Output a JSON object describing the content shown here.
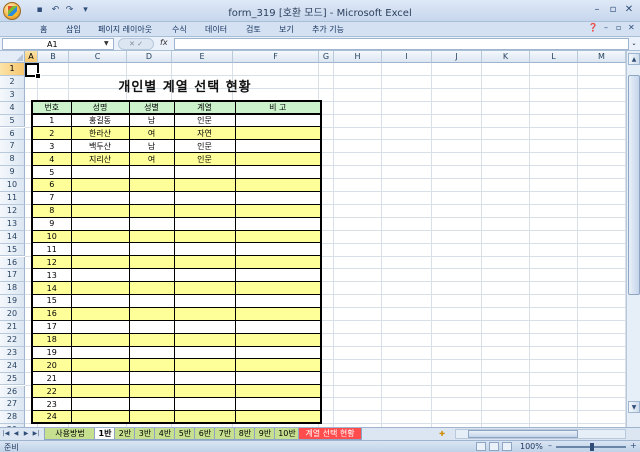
{
  "window": {
    "title": "form_319  [호환 모드] - Microsoft Excel"
  },
  "ribbon": {
    "tabs": [
      "홈",
      "삽입",
      "페이지 레이아웃",
      "수식",
      "데이터",
      "검토",
      "보기",
      "추가 기능"
    ]
  },
  "formula_bar": {
    "name_box": "A1",
    "fx": "fx",
    "formula": ""
  },
  "columns": [
    "A",
    "B",
    "C",
    "D",
    "E",
    "F",
    "G",
    "H",
    "I",
    "J",
    "K",
    "L",
    "M",
    "N"
  ],
  "rows": [
    "1",
    "2",
    "3",
    "4",
    "5",
    "6",
    "7",
    "8",
    "9",
    "10",
    "11",
    "12",
    "13",
    "14",
    "15",
    "16",
    "17",
    "18",
    "19",
    "20",
    "21",
    "22",
    "23",
    "24",
    "25",
    "26",
    "27",
    "28",
    "29"
  ],
  "sheet": {
    "title": "개인별 계열 선택 현황",
    "headers": [
      "번호",
      "성명",
      "성별",
      "계열",
      "비 고"
    ],
    "records": [
      [
        "1",
        "홍길동",
        "남",
        "인문",
        ""
      ],
      [
        "2",
        "한라산",
        "여",
        "자연",
        ""
      ],
      [
        "3",
        "백두산",
        "남",
        "인문",
        ""
      ],
      [
        "4",
        "지리산",
        "여",
        "인문",
        ""
      ],
      [
        "5",
        "",
        "",
        "",
        ""
      ],
      [
        "6",
        "",
        "",
        "",
        ""
      ],
      [
        "7",
        "",
        "",
        "",
        ""
      ],
      [
        "8",
        "",
        "",
        "",
        ""
      ],
      [
        "9",
        "",
        "",
        "",
        ""
      ],
      [
        "10",
        "",
        "",
        "",
        ""
      ],
      [
        "11",
        "",
        "",
        "",
        ""
      ],
      [
        "12",
        "",
        "",
        "",
        ""
      ],
      [
        "13",
        "",
        "",
        "",
        ""
      ],
      [
        "14",
        "",
        "",
        "",
        ""
      ],
      [
        "15",
        "",
        "",
        "",
        ""
      ],
      [
        "16",
        "",
        "",
        "",
        ""
      ],
      [
        "17",
        "",
        "",
        "",
        ""
      ],
      [
        "18",
        "",
        "",
        "",
        ""
      ],
      [
        "19",
        "",
        "",
        "",
        ""
      ],
      [
        "20",
        "",
        "",
        "",
        ""
      ],
      [
        "21",
        "",
        "",
        "",
        ""
      ],
      [
        "22",
        "",
        "",
        "",
        ""
      ],
      [
        "23",
        "",
        "",
        "",
        ""
      ],
      [
        "24",
        "",
        "",
        "",
        ""
      ]
    ]
  },
  "sheet_tabs": [
    {
      "label": "사용방법",
      "style": "normal"
    },
    {
      "label": "1반",
      "style": "active"
    },
    {
      "label": "2반",
      "style": "normal"
    },
    {
      "label": "3반",
      "style": "normal"
    },
    {
      "label": "4반",
      "style": "normal"
    },
    {
      "label": "5반",
      "style": "normal"
    },
    {
      "label": "6반",
      "style": "normal"
    },
    {
      "label": "7반",
      "style": "normal"
    },
    {
      "label": "8반",
      "style": "normal"
    },
    {
      "label": "9반",
      "style": "normal"
    },
    {
      "label": "10반",
      "style": "normal"
    },
    {
      "label": "계열 선택 현황",
      "style": "red"
    }
  ],
  "status": {
    "text": "준비",
    "zoom": "100%"
  },
  "colors": {
    "header_fill": "#ccf2cc",
    "band_fill": "#ffff99",
    "highlight_tab": "#ff4d4d"
  }
}
